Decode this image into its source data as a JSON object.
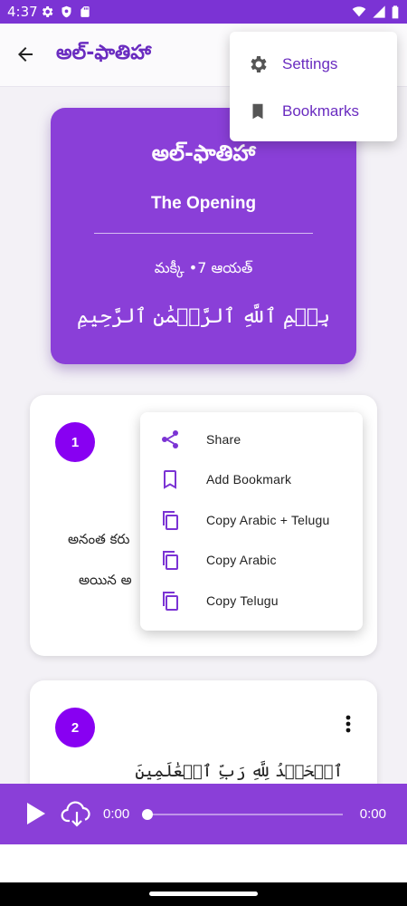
{
  "status_bar": {
    "time": "4:37",
    "background": "#7b33d4"
  },
  "app_bar": {
    "title": "అల్-ఫాతిహా",
    "back_icon": "arrow-left-icon"
  },
  "top_menu": {
    "items": [
      {
        "label": "Settings",
        "icon": "gear-icon"
      },
      {
        "label": "Bookmarks",
        "icon": "bookmark-icon"
      }
    ]
  },
  "surah_header": {
    "name_telugu": "అల్-ఫాతిహా",
    "name_english": "The Opening",
    "meta": "మక్కీ •7 ఆయత్",
    "bismillah": "بِسۡمِ ٱللَّهِ ٱلرَّحۡمَٰنِ ٱلرَّحِيمِ"
  },
  "verses": [
    {
      "number": "1",
      "telugu_line1": "అనంత కరు",
      "telugu_line2": "అయిన అ"
    },
    {
      "number": "2",
      "arabic": "ٱلۡحَمۡدُ لِلَّهِ رَبِّ ٱلۡعَٰلَمِينَ"
    }
  ],
  "verse_menu": {
    "items": [
      {
        "label": "Share",
        "icon": "share-icon"
      },
      {
        "label": "Add Bookmark",
        "icon": "bookmark-outline-icon"
      },
      {
        "label": "Copy Arabic + Telugu",
        "icon": "copy-icon"
      },
      {
        "label": "Copy Arabic",
        "icon": "copy-icon"
      },
      {
        "label": "Copy Telugu",
        "icon": "copy-icon"
      }
    ]
  },
  "player": {
    "current_time": "0:00",
    "total_time": "0:00",
    "progress": 0
  },
  "colors": {
    "primary": "#8a3fd8",
    "accent_text": "#6a2cc0",
    "verse_badge": "#8800f2"
  }
}
